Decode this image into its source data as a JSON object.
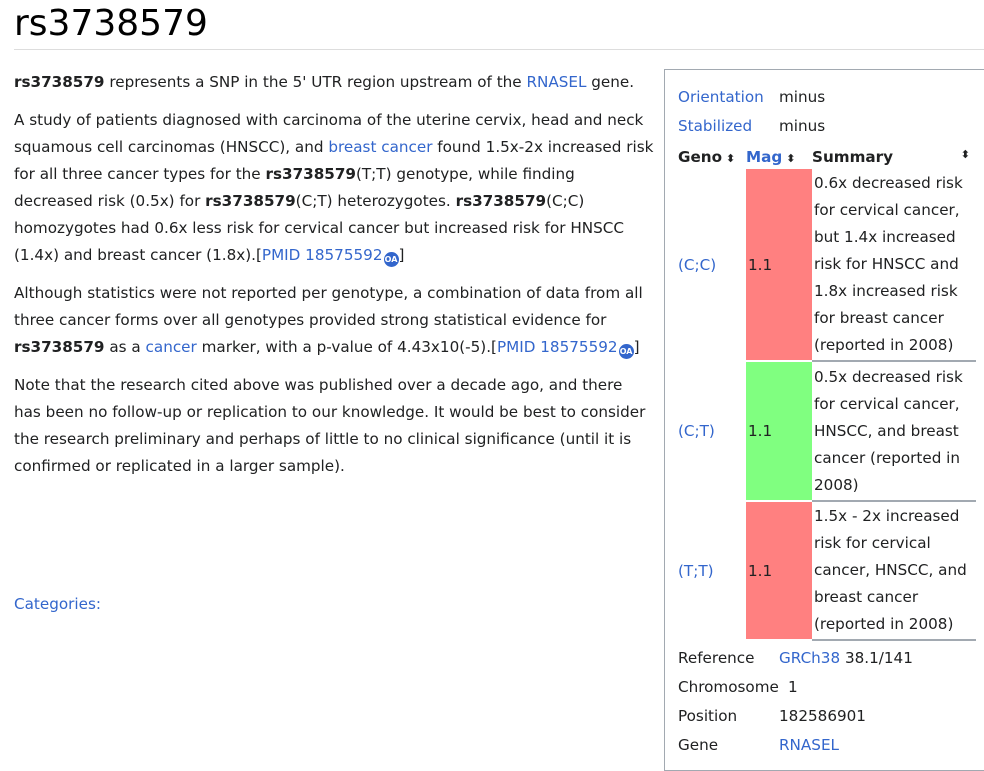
{
  "page": {
    "title": "rs3738579"
  },
  "content": {
    "p1": {
      "rsid": "rs3738579",
      "t1": " represents a SNP in the 5' UTR region upstream of the ",
      "gene_link": "RNASEL",
      "t2": " gene."
    },
    "p2": {
      "t1": "A study of patients diagnosed with carcinoma of the uterine cervix, head and neck squamous cell carcinomas (HNSCC), and ",
      "link_breast": "breast cancer",
      "t2": " found 1.5x-2x increased risk for all three cancer types for the ",
      "rsid": "rs3738579",
      "t3": "(T;T) genotype, while finding decreased risk (0.5x) for ",
      "t4": "(C;T) heterozygotes. ",
      "t5": "(C;C) homozygotes had 0.6x less risk for cervical cancer but increased risk for HNSCC (1.4x) and breast cancer (1.8x).[",
      "pmid_link": "PMID 18575592",
      "oa": "OA",
      "t6": "]"
    },
    "p3": {
      "t1": "Although statistics were not reported per genotype, a combination of data from all three cancer forms over all genotypes provided strong statistical evidence for ",
      "rsid": "rs3738579",
      "t2": " as a ",
      "link_cancer": "cancer",
      "t3": " marker, with a p-value of 4.43x10(-5).[",
      "pmid_link": "PMID 18575592",
      "oa": "OA",
      "t4": "]"
    },
    "p4": {
      "text": "Note that the research cited above was published over a decade ago, and there has been no follow-up or replication to our knowledge. It would be best to consider the research preliminary and perhaps of little to no clinical significance (until it is confirmed or replicated in a larger sample)."
    },
    "categories_label": "Categories",
    "categories_colon": ":"
  },
  "infobox": {
    "orientation": {
      "label": "Orientation",
      "value": "minus"
    },
    "stabilized": {
      "label": "Stabilized",
      "value": "minus"
    },
    "table": {
      "headers": {
        "geno": "Geno",
        "mag": "Mag",
        "summary": "Summary",
        "sort_glyph": "⬍"
      },
      "rows": [
        {
          "geno": "(C;C)",
          "mag": "1.1",
          "color": "#ff8080",
          "summary": "0.6x decreased risk for cervical cancer, but 1.4x increased risk for HNSCC and 1.8x increased risk for breast cancer (reported in 2008)"
        },
        {
          "geno": "(C;T)",
          "mag": "1.1",
          "color": "#80ff80",
          "summary": "0.5x decreased risk for cervical cancer, HNSCC, and breast cancer (reported in 2008)"
        },
        {
          "geno": "(T;T)",
          "mag": "1.1",
          "color": "#ff8080",
          "summary": "1.5x - 2x increased risk for cervical cancer, HNSCC, and breast cancer (reported in 2008)"
        }
      ]
    },
    "reference": {
      "label": "Reference",
      "link": "GRCh38",
      "value": " 38.1/141"
    },
    "chromosome": {
      "label": "Chromosome",
      "value": "1"
    },
    "position": {
      "label": "Position",
      "value": "182586901"
    },
    "gene": {
      "label": "Gene",
      "link": "RNASEL"
    }
  },
  "colors": {
    "link": "#3366cc",
    "text": "#202122",
    "risk": "#ff8080",
    "protective": "#80ff80",
    "border": "#a2a9b1"
  }
}
